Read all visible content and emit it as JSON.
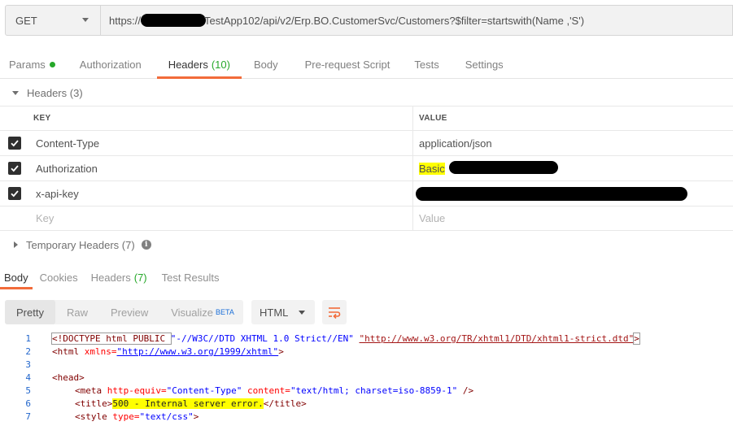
{
  "request": {
    "method": "GET",
    "url_prefix": "https://",
    "url_suffix": "TestApp102/api/v2/Erp.BO.CustomerSvc/Customers?$filter=startswith(Name ,'S')"
  },
  "request_tabs": [
    {
      "label": "Params",
      "count": ""
    },
    {
      "label": "Authorization",
      "count": ""
    },
    {
      "label": "Headers",
      "count": "(10)"
    },
    {
      "label": "Body",
      "count": ""
    },
    {
      "label": "Pre-request Script",
      "count": ""
    },
    {
      "label": "Tests",
      "count": ""
    },
    {
      "label": "Settings",
      "count": ""
    }
  ],
  "headers_section": {
    "title": "Headers",
    "count": "(3)",
    "columns": {
      "key": "KEY",
      "value": "VALUE"
    },
    "rows": [
      {
        "key": "Content-Type",
        "value": "application/json"
      },
      {
        "key": "Authorization",
        "value": "Basic"
      },
      {
        "key": "x-api-key",
        "value": ""
      }
    ],
    "new_row": {
      "key_placeholder": "Key",
      "value_placeholder": "Value"
    }
  },
  "temporary_headers": {
    "title": "Temporary Headers",
    "count": "(7)"
  },
  "response_tabs": [
    {
      "label": "Body",
      "count": ""
    },
    {
      "label": "Cookies",
      "count": ""
    },
    {
      "label": "Headers",
      "count": "(7)"
    },
    {
      "label": "Test Results",
      "count": ""
    }
  ],
  "view_modes": [
    {
      "label": "Pretty",
      "badge": ""
    },
    {
      "label": "Raw",
      "badge": ""
    },
    {
      "label": "Preview",
      "badge": ""
    },
    {
      "label": "Visualize",
      "badge": "BETA"
    }
  ],
  "format": "HTML",
  "code_lines": [
    "1",
    "2",
    "3",
    "4",
    "5",
    "6",
    "7"
  ],
  "code": {
    "l1_open": "<!DOCTYPE html PUBLIC ",
    "l1_fpi": "\"-//W3C//DTD XHTML 1.0 Strict//EN\"",
    "l1_sp": " ",
    "l1_dtd": "\"http://www.w3.org/TR/xhtml1/DTD/xhtml1-strict.dtd\"",
    "l1_close": ">",
    "l2_tag": "<html ",
    "l2_attr": "xmlns=",
    "l2_val": "\"http://www.w3.org/1999/xhtml\"",
    "l2_close": ">",
    "l4": "<head>",
    "l5_tag": "<meta ",
    "l5_attr1": "http-equiv=",
    "l5_val1": "\"Content-Type\"",
    "l5_attr2": " content=",
    "l5_val2": "\"text/html; charset=iso-8859-1\"",
    "l5_close": " />",
    "l6_open": "<title>",
    "l6_text": "500 - Internal server error.",
    "l6_close": "</title>",
    "l7_tag": "<style ",
    "l7_attr": "type=",
    "l7_val": "\"text/css\"",
    "l7_close": ">"
  },
  "colors": {
    "accent": "#f26b3a",
    "count_green": "#26a82a",
    "highlight": "#ffff00"
  }
}
